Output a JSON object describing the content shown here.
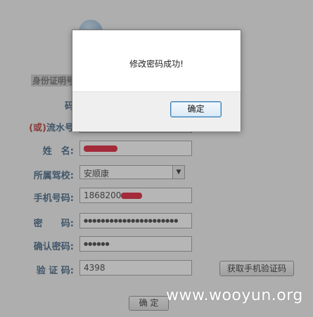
{
  "header": {
    "title": ""
  },
  "form": {
    "section_title": "身份证明号",
    "fields": {
      "code": {
        "label": "码"
      },
      "serial": {
        "label_prefix": "(或)",
        "label": "流水号"
      },
      "name": {
        "label": "姓　名:"
      },
      "school": {
        "label": "所属驾校:",
        "selected": "安顺康"
      },
      "phone": {
        "label": "手机号码:",
        "value": "1868200"
      },
      "password": {
        "label": "密　　码:",
        "value": "●●●●●●●●●●●●●●●●●●●●●●"
      },
      "confirm": {
        "label": "确认密码:",
        "value": "●●●●●●"
      },
      "captcha": {
        "label": "验 证 码:",
        "value": "4398"
      }
    },
    "sms_button": "获取手机验证码",
    "submit_button": "确 定"
  },
  "dialog": {
    "message": "修改密码成功!",
    "ok_button": "确定"
  },
  "watermark": "www.wooyun.org",
  "colors": {
    "label": "#355a7a",
    "accent_red": "#b03030",
    "redaction": "#e0102a"
  }
}
